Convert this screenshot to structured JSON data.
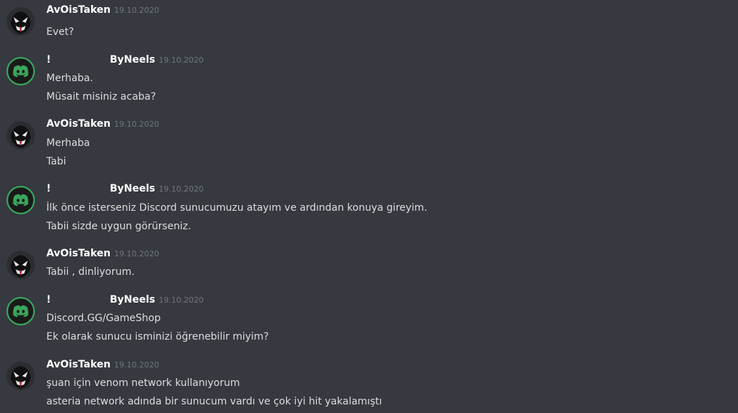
{
  "colors": {
    "background": "#36393f",
    "username": "#ffffff",
    "timestamp": "#72767d",
    "message_text": "#dcddde",
    "discord_avatar_ring": "#3ba55c",
    "discord_avatar_fill": "#1a1a1a"
  },
  "avatar_icons": {
    "avoistaken": "venom-avatar-icon",
    "byneels": "discord-logo-icon"
  },
  "groups": [
    {
      "author": "AvOisTaken",
      "timestamp": "19.10.2020",
      "lines": [
        "Evet?"
      ]
    },
    {
      "author_prefix": "!",
      "author": "ByNeels",
      "timestamp": "19.10.2020",
      "lines": [
        "Merhaba.",
        "Müsait misiniz acaba?"
      ]
    },
    {
      "author": "AvOisTaken",
      "timestamp": "19.10.2020",
      "lines": [
        "Merhaba",
        "Tabi"
      ]
    },
    {
      "author_prefix": "!",
      "author": "ByNeels",
      "timestamp": "19.10.2020",
      "lines": [
        "İlk önce isterseniz Discord sunucumuzu atayım ve ardından konuya gireyim.",
        "Tabii sizde uygun görürseniz."
      ]
    },
    {
      "author": "AvOisTaken",
      "timestamp": "19.10.2020",
      "lines": [
        "Tabii , dinliyorum."
      ]
    },
    {
      "author_prefix": "!",
      "author": "ByNeels",
      "timestamp": "19.10.2020",
      "lines": [
        "Discord.GG/GameShop",
        "Ek olarak sunucu isminizi öğrenebilir miyim?"
      ]
    },
    {
      "author": "AvOisTaken",
      "timestamp": "19.10.2020",
      "lines": [
        "şuan için venom network kullanıyorum",
        "asteria network adında bir sunucum vardı ve çok iyi hit yakalamıştı"
      ]
    }
  ]
}
